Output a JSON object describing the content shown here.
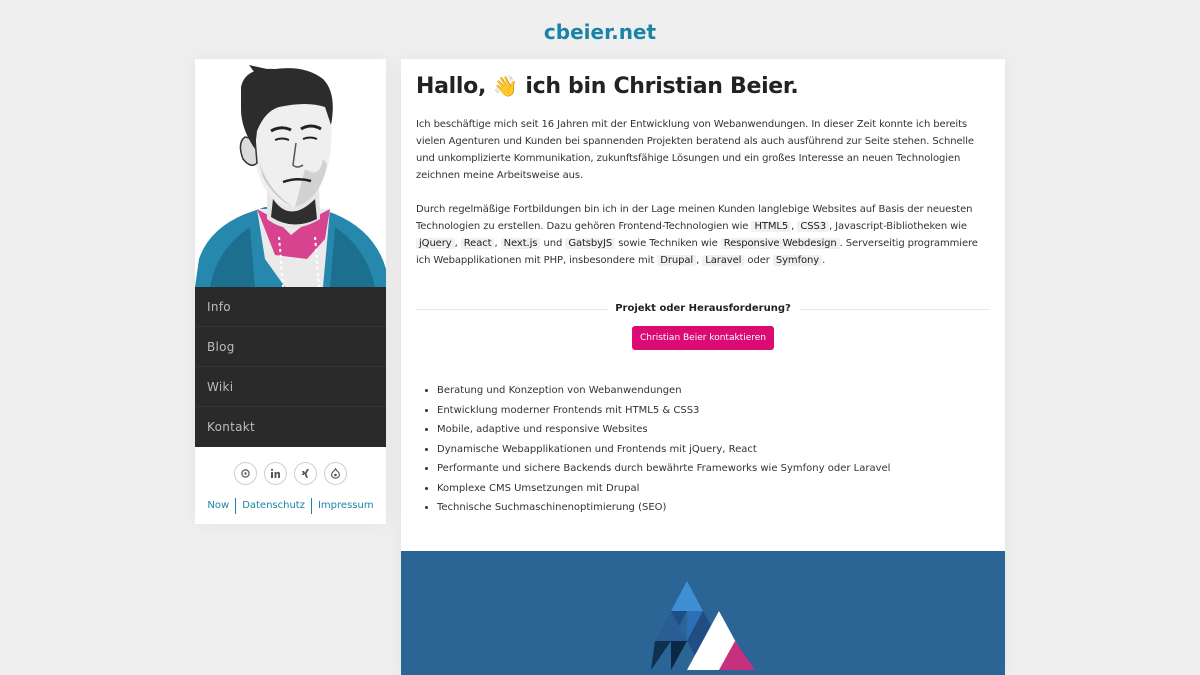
{
  "site": {
    "title": "cbeier.net"
  },
  "sidebar": {
    "nav": [
      {
        "label": "Info"
      },
      {
        "label": "Blog"
      },
      {
        "label": "Wiki"
      },
      {
        "label": "Kontakt"
      }
    ],
    "social": [
      {
        "icon": "mastodon-icon"
      },
      {
        "icon": "linkedin-icon"
      },
      {
        "icon": "xing-icon"
      },
      {
        "icon": "drupal-icon"
      }
    ],
    "footer_links": [
      {
        "label": "Now"
      },
      {
        "label": "Datenschutz"
      },
      {
        "label": "Impressum"
      }
    ]
  },
  "main": {
    "heading": {
      "pre": "Hallo,",
      "emoji": "👋",
      "post": "ich bin Christian Beier."
    },
    "para1": "Ich beschäftige mich seit 16 Jahren mit der Entwicklung von Webanwendungen. In dieser Zeit konnte ich bereits vielen Agenturen und Kunden bei spannenden Projekten beratend als auch ausführend zur Seite stehen. Schnelle und unkomplizierte Kommunikation, zukunftsfähige Lösungen und ein großes Interesse an neuen Technologien zeichnen meine Arbeitsweise aus.",
    "para2": {
      "t1": "Durch regelmäßige Fortbildungen bin ich in der Lage meinen Kunden langlebige Websites auf Basis der neuesten Technologien zu erstellen. Dazu gehören Frontend-Technologien wie",
      "tag_html5": "HTML5",
      "tag_css3": "CSS3",
      "t2": ", Javascript-Bibliotheken wie",
      "tag_jquery": "jQuery",
      "tag_react": "React",
      "tag_nextjs": "Next.js",
      "t3": "und",
      "tag_gatsby": "GatsbyJS",
      "t4": "sowie Techniken wie",
      "tag_responsive": "Responsive Webdesign",
      "t5": ". Serverseitig programmiere ich Webapplikationen mit PHP, insbesondere mit",
      "tag_drupal": "Drupal",
      "tag_laravel": "Laravel",
      "t6": "oder",
      "tag_symfony": "Symfony",
      "t7": "."
    },
    "cta": {
      "title": "Projekt oder Herausforderung?",
      "button": "Christian Beier kontaktieren"
    },
    "services": [
      "Beratung und Konzeption von Webanwendungen",
      "Entwicklung moderner Frontends mit HTML5 & CSS3",
      "Mobile, adaptive und responsive Websites",
      "Dynamische Webapplikationen und Frontends mit jQuery, React",
      "Performante und sichere Backends durch bewährte Frameworks wie Symfony oder Laravel",
      "Komplexe CMS Umsetzungen mit Drupal",
      "Technische Suchmaschinenoptimierung (SEO)"
    ]
  },
  "colors": {
    "brand_blue": "#1a84a6",
    "accent_pink": "#dc0a73",
    "nav_bg": "#2a2a2a",
    "footer_band": "#2a6595"
  }
}
